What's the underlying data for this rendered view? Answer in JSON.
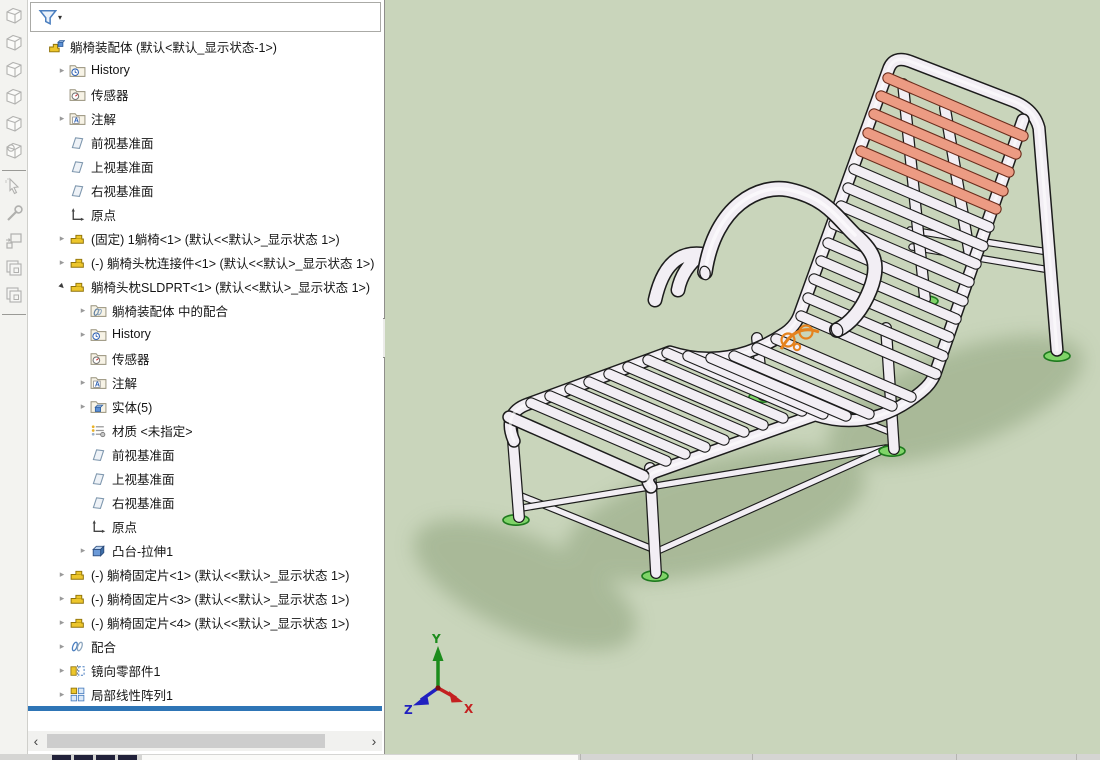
{
  "left_toolbar": {
    "icons": [
      "view-cube",
      "view-cube",
      "view-cube",
      "view-cube",
      "view-cube",
      "view-cube-section",
      "select-cursor",
      "tools-wrench",
      "move-component",
      "layers-stack",
      "layers-stack"
    ]
  },
  "feature_tree": {
    "rows": [
      {
        "label": "躺椅装配体 (默认<默认_显示状态-1>)",
        "icon": "assembly",
        "arrow": "",
        "indent": 0
      },
      {
        "label": "History",
        "icon": "history",
        "arrow": "c",
        "indent": 1
      },
      {
        "label": "传感器",
        "icon": "sensors",
        "arrow": "",
        "indent": 1
      },
      {
        "label": "注解",
        "icon": "annotation",
        "arrow": "c",
        "indent": 1
      },
      {
        "label": "前视基准面",
        "icon": "plane",
        "arrow": "",
        "indent": 1
      },
      {
        "label": "上视基准面",
        "icon": "plane",
        "arrow": "",
        "indent": 1
      },
      {
        "label": "右视基准面",
        "icon": "plane",
        "arrow": "",
        "indent": 1
      },
      {
        "label": "原点",
        "icon": "origin",
        "arrow": "",
        "indent": 1
      },
      {
        "label": "(固定) 1躺椅<1> (默认<<默认>_显示状态 1>)",
        "icon": "part",
        "arrow": "c",
        "indent": 1
      },
      {
        "label": "(-) 躺椅头枕连接件<1> (默认<<默认>_显示状态 1>)",
        "icon": "part",
        "arrow": "c",
        "indent": 1
      },
      {
        "label": "躺椅头枕SLDPRT<1> (默认<<默认>_显示状态 1>)",
        "icon": "part",
        "arrow": "e",
        "indent": 1
      },
      {
        "label": "躺椅装配体 中的配合",
        "icon": "matesfld",
        "arrow": "c",
        "indent": 2
      },
      {
        "label": "History",
        "icon": "history",
        "arrow": "c",
        "indent": 2
      },
      {
        "label": "传感器",
        "icon": "sensors",
        "arrow": "",
        "indent": 2
      },
      {
        "label": "注解",
        "icon": "annotation",
        "arrow": "c",
        "indent": 2
      },
      {
        "label": "实体(5)",
        "icon": "solids",
        "arrow": "c",
        "indent": 2
      },
      {
        "label": "材质 <未指定>",
        "icon": "material",
        "arrow": "",
        "indent": 2
      },
      {
        "label": "前视基准面",
        "icon": "plane",
        "arrow": "",
        "indent": 2
      },
      {
        "label": "上视基准面",
        "icon": "plane",
        "arrow": "",
        "indent": 2
      },
      {
        "label": "右视基准面",
        "icon": "plane",
        "arrow": "",
        "indent": 2
      },
      {
        "label": "原点",
        "icon": "origin",
        "arrow": "",
        "indent": 2
      },
      {
        "label": "凸台-拉伸1",
        "icon": "extrude",
        "arrow": "c",
        "indent": 2
      },
      {
        "label": "(-) 躺椅固定片<1> (默认<<默认>_显示状态 1>)",
        "icon": "part",
        "arrow": "c",
        "indent": 1
      },
      {
        "label": "(-) 躺椅固定片<3> (默认<<默认>_显示状态 1>)",
        "icon": "part",
        "arrow": "c",
        "indent": 1
      },
      {
        "label": "(-) 躺椅固定片<4> (默认<<默认>_显示状态 1>)",
        "icon": "part",
        "arrow": "c",
        "indent": 1
      },
      {
        "label": "配合",
        "icon": "mates",
        "arrow": "c",
        "indent": 1
      },
      {
        "label": "镜向零部件1",
        "icon": "mirror",
        "arrow": "c",
        "indent": 1
      },
      {
        "label": "局部线性阵列1",
        "icon": "pattern",
        "arrow": "c",
        "indent": 1
      }
    ]
  },
  "panel_scrollbar": {
    "left_arrow": "‹",
    "right_arrow": "›"
  },
  "splitter_color": "#2e75b6",
  "viewport": {
    "background_color": "#c9d5bb",
    "shadow_color": "#9bae8a",
    "triad": {
      "labels": {
        "x": "X",
        "y": "Y",
        "z": "Z"
      },
      "colors": {
        "x": "#c42020",
        "y": "#1c8c1c",
        "z": "#2020c0"
      }
    },
    "model": {
      "subject": "躺椅 lounge chair assembly",
      "tube_fill": "#f2eef4",
      "outline": "#1c1c1c",
      "headrest_slat_fill": "#ec9b83",
      "headrest_slat_outline": "#6a2c1c",
      "foot_color": "#7fd468",
      "foot_outline": "#1e7a1e",
      "selection_highlight": "#e5821e",
      "slat_counts": {
        "foot_section": 8,
        "seat_section": 5,
        "backrest_white": 9,
        "backrest_salmon": 5
      }
    }
  }
}
